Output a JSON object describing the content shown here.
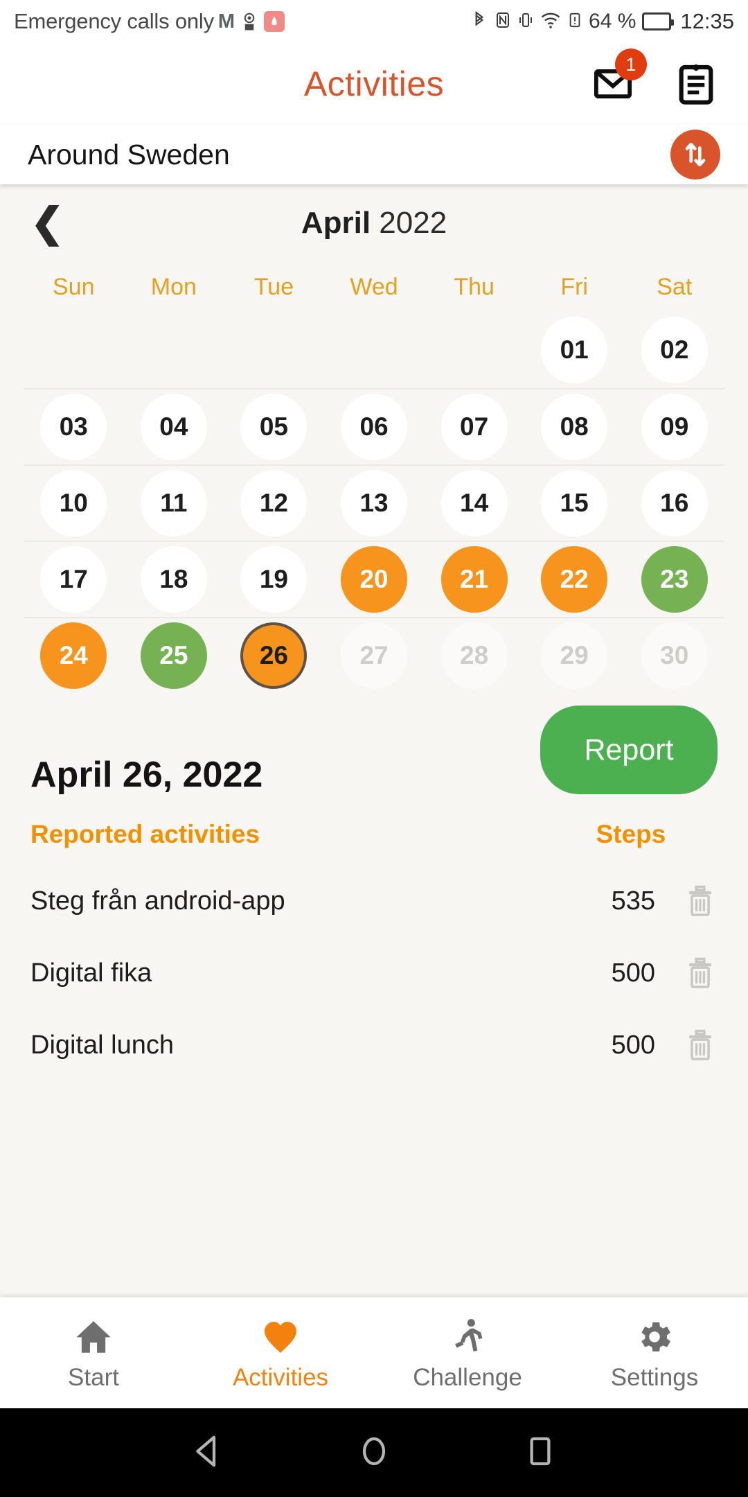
{
  "status_bar": {
    "carrier_text": "Emergency calls only",
    "icons": [
      "gmail-icon",
      "podcast-icon",
      "huawei-icon",
      "bluetooth-icon",
      "nfc-icon",
      "vibrate-icon",
      "wifi-icon",
      "sim-alert-icon"
    ],
    "battery_percent": "64 %",
    "time": "12:35"
  },
  "header": {
    "title": "Activities",
    "title_color": "#d9542b",
    "mail_badge": "1"
  },
  "subheader": {
    "title": "Around Sweden",
    "sync_color": "#d9542b"
  },
  "calendar": {
    "month": "April",
    "year": "2022",
    "day_headers": [
      "Sun",
      "Mon",
      "Tue",
      "Wed",
      "Thu",
      "Fri",
      "Sat"
    ],
    "day_header_color": "#e5a020",
    "legend_colors": {
      "orange": "#f7941d",
      "green": "#76b254",
      "normal": "#ffffff",
      "dim": "#fbfaf8"
    },
    "weeks": [
      [
        {
          "label": "",
          "state": "empty"
        },
        {
          "label": "",
          "state": "empty"
        },
        {
          "label": "",
          "state": "empty"
        },
        {
          "label": "",
          "state": "empty"
        },
        {
          "label": "",
          "state": "empty"
        },
        {
          "label": "01",
          "state": "normal"
        },
        {
          "label": "02",
          "state": "normal"
        }
      ],
      [
        {
          "label": "03",
          "state": "normal"
        },
        {
          "label": "04",
          "state": "normal"
        },
        {
          "label": "05",
          "state": "normal"
        },
        {
          "label": "06",
          "state": "normal"
        },
        {
          "label": "07",
          "state": "normal"
        },
        {
          "label": "08",
          "state": "normal"
        },
        {
          "label": "09",
          "state": "normal"
        }
      ],
      [
        {
          "label": "10",
          "state": "normal"
        },
        {
          "label": "11",
          "state": "normal"
        },
        {
          "label": "12",
          "state": "normal"
        },
        {
          "label": "13",
          "state": "normal"
        },
        {
          "label": "14",
          "state": "normal"
        },
        {
          "label": "15",
          "state": "normal"
        },
        {
          "label": "16",
          "state": "normal"
        }
      ],
      [
        {
          "label": "17",
          "state": "normal"
        },
        {
          "label": "18",
          "state": "normal"
        },
        {
          "label": "19",
          "state": "normal"
        },
        {
          "label": "20",
          "state": "orange"
        },
        {
          "label": "21",
          "state": "orange"
        },
        {
          "label": "22",
          "state": "orange"
        },
        {
          "label": "23",
          "state": "green"
        }
      ],
      [
        {
          "label": "24",
          "state": "orange"
        },
        {
          "label": "25",
          "state": "green"
        },
        {
          "label": "26",
          "state": "selected"
        },
        {
          "label": "27",
          "state": "dim"
        },
        {
          "label": "28",
          "state": "dim"
        },
        {
          "label": "29",
          "state": "dim"
        },
        {
          "label": "30",
          "state": "dim"
        }
      ]
    ]
  },
  "detail": {
    "selected_date": "April 26, 2022",
    "report_button": "Report",
    "report_color": "#4caf50"
  },
  "table": {
    "header_activities": "Reported activities",
    "header_steps": "Steps",
    "header_color": "#f29100",
    "rows": [
      {
        "activity": "Steg från android-app",
        "steps": "535"
      },
      {
        "activity": "Digital fika",
        "steps": "500"
      },
      {
        "activity": "Digital lunch",
        "steps": "500"
      }
    ]
  },
  "bottom_nav": {
    "active": "Activities",
    "items": [
      {
        "label": "Start",
        "icon": "home-icon"
      },
      {
        "label": "Activities",
        "icon": "heart-icon"
      },
      {
        "label": "Challenge",
        "icon": "running-icon"
      },
      {
        "label": "Settings",
        "icon": "gear-icon"
      }
    ]
  },
  "android_nav": {
    "items": [
      "back-icon",
      "home-icon",
      "recents-icon"
    ]
  }
}
